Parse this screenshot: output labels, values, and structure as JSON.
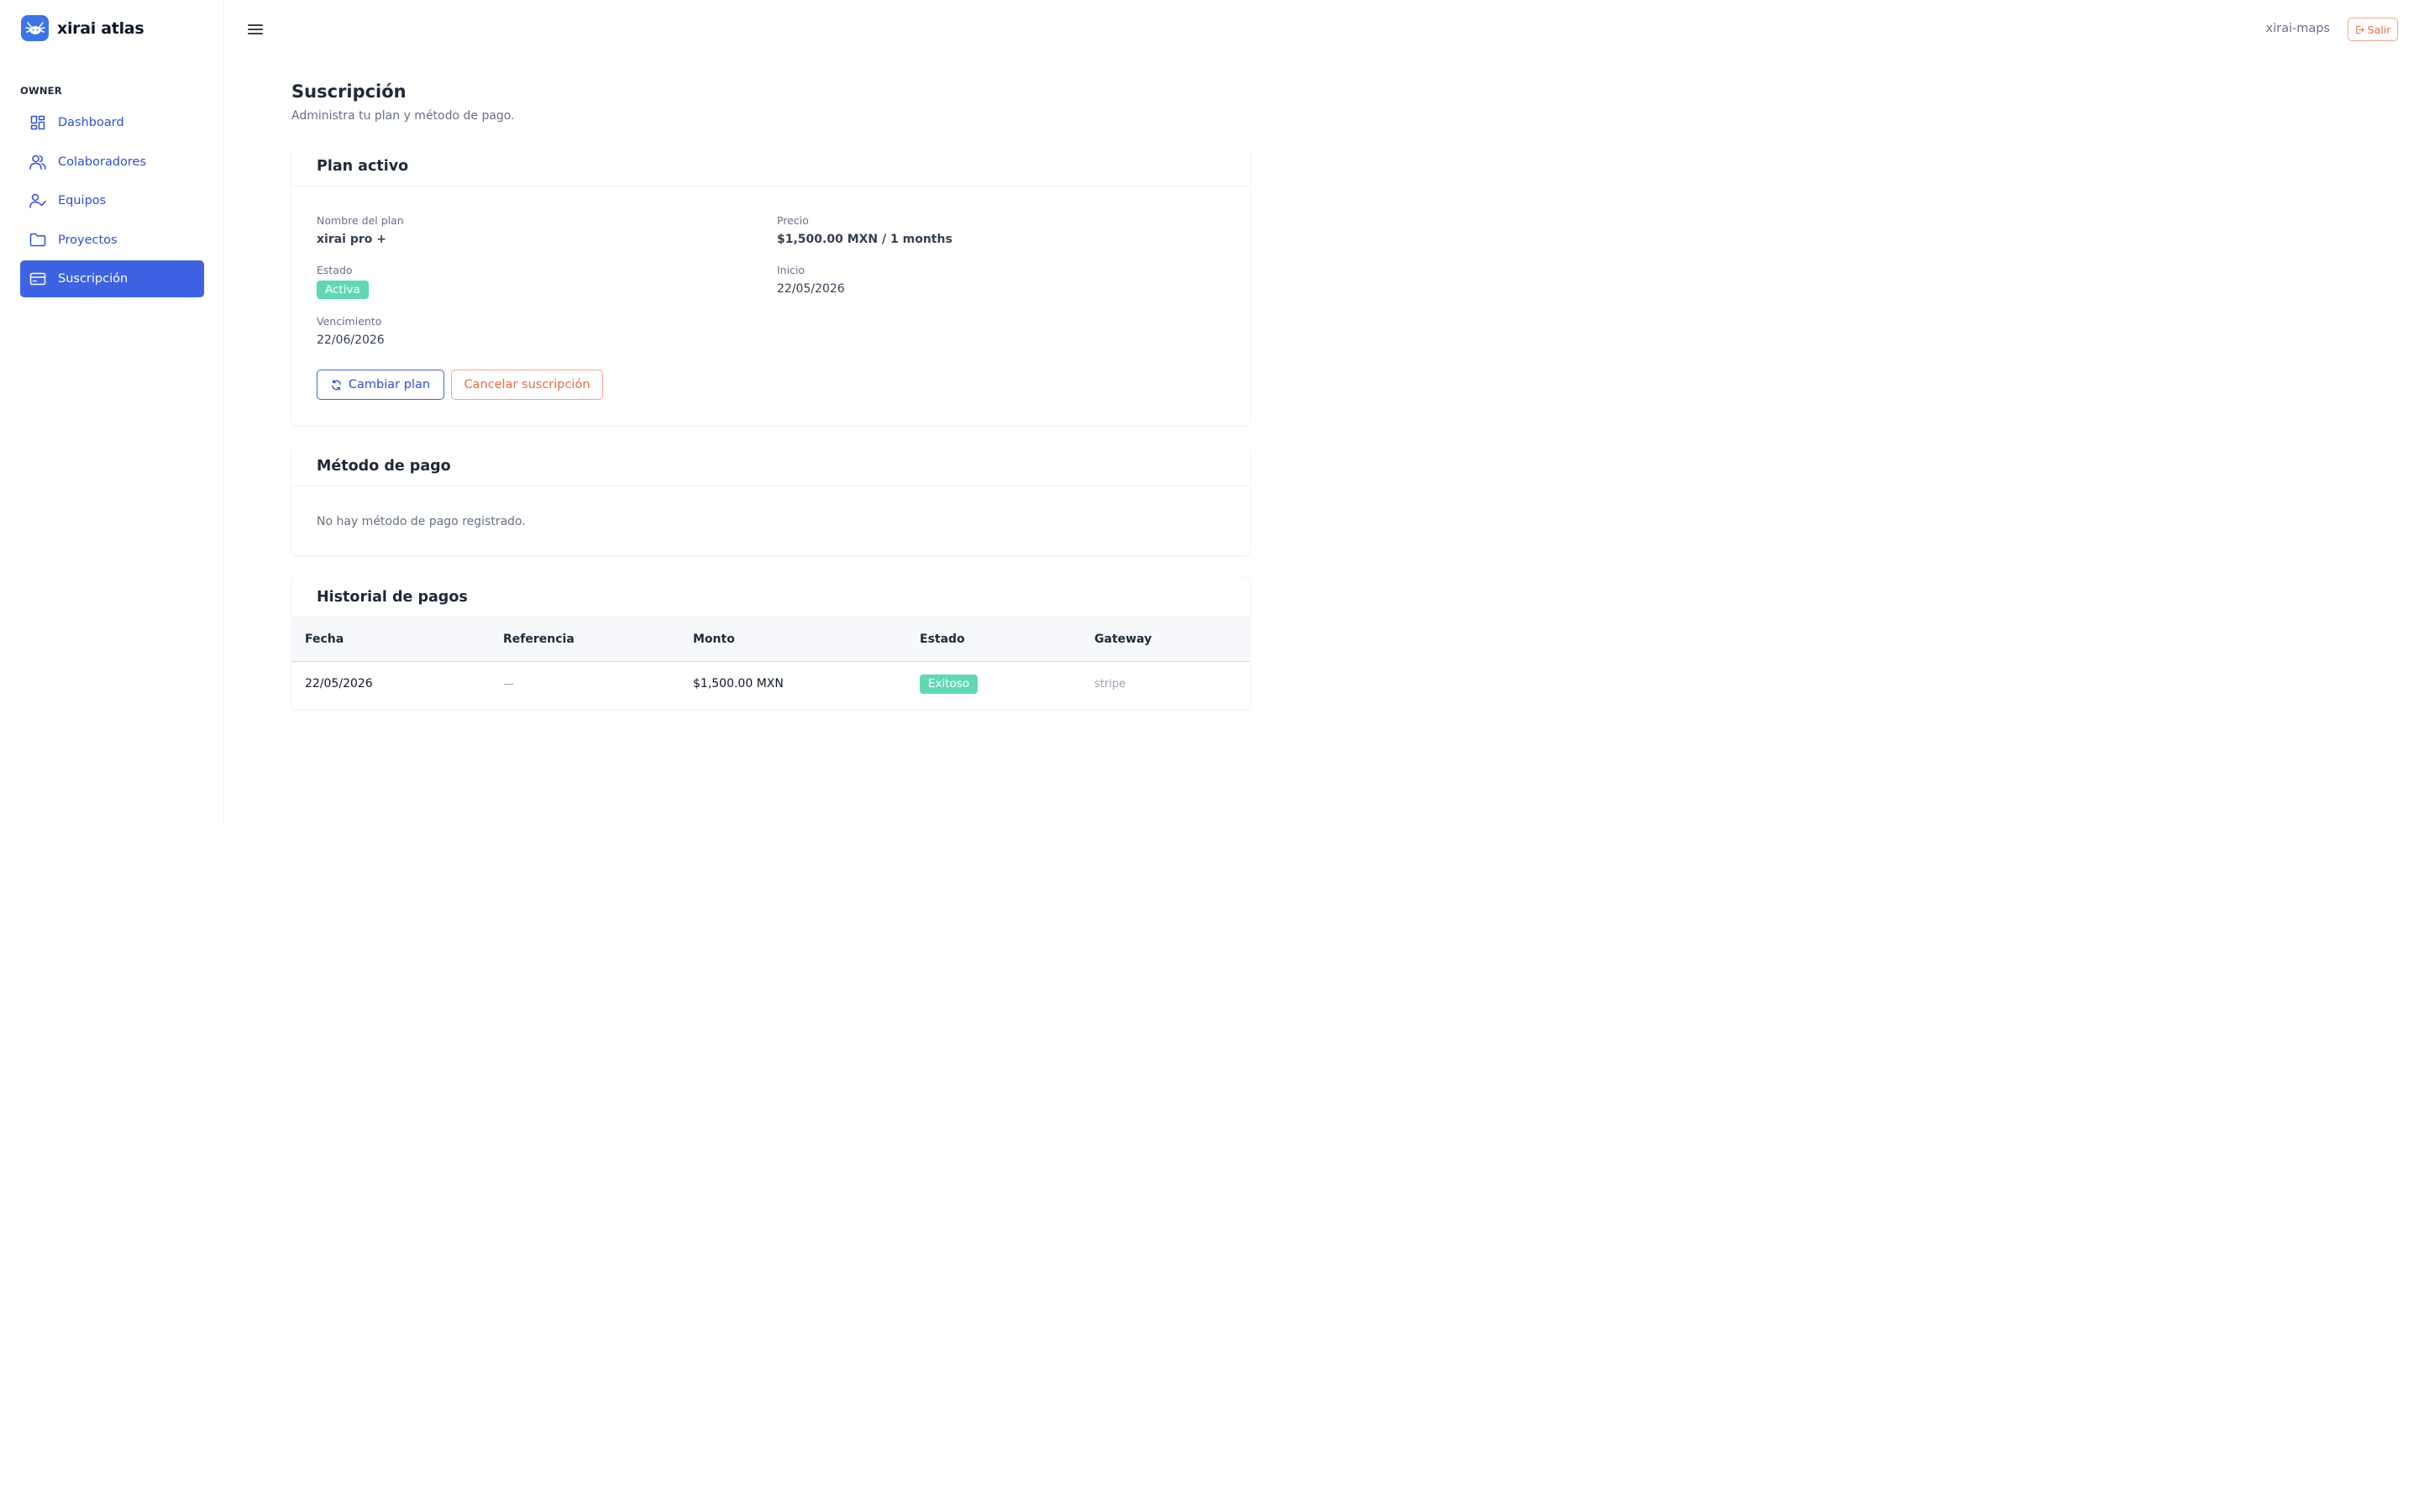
{
  "brand": {
    "name": "xirai atlas",
    "logo_icon": "axolotl-logo-icon",
    "logo_color": "#3d74e8"
  },
  "sidebar": {
    "section_label": "OWNER",
    "items": [
      {
        "label": "Dashboard",
        "icon": "dashboard-grid-icon",
        "active": false
      },
      {
        "label": "Colaboradores",
        "icon": "users-icon",
        "active": false
      },
      {
        "label": "Equipos",
        "icon": "user-check-icon",
        "active": false
      },
      {
        "label": "Proyectos",
        "icon": "folder-icon",
        "active": false
      },
      {
        "label": "Suscripción",
        "icon": "credit-card-icon",
        "active": true
      }
    ]
  },
  "topbar": {
    "menu_icon": "hamburger-menu-icon",
    "workspace": "xirai-maps",
    "logout_label": "Salir",
    "logout_icon": "logout-icon"
  },
  "page": {
    "title": "Suscripción",
    "subtitle": "Administra tu plan y método de pago."
  },
  "plan_card": {
    "title": "Plan activo",
    "plan_name_label": "Nombre del plan",
    "plan_name": "xirai pro +",
    "price_label": "Precio",
    "price": "$1,500.00 MXN / 1 months",
    "status_label": "Estado",
    "status": "Activa",
    "start_label": "Inicio",
    "start": "22/05/2026",
    "expiry_label": "Vencimiento",
    "expiry": "22/06/2026",
    "change_plan_label": "Cambiar plan",
    "cancel_label": "Cancelar suscripción"
  },
  "payment_card": {
    "title": "Método de pago",
    "empty": "No hay método de pago registrado."
  },
  "history_card": {
    "title": "Historial de pagos",
    "columns": [
      "Fecha",
      "Referencia",
      "Monto",
      "Estado",
      "Gateway"
    ],
    "rows": [
      {
        "fecha": "22/05/2026",
        "referencia": "—",
        "monto": "$1,500.00 MXN",
        "estado": "Exitoso",
        "gateway": "stripe"
      }
    ]
  },
  "colors": {
    "primary": "#3d63e2",
    "danger": "#ee6a42",
    "success": "#61d8b5"
  }
}
